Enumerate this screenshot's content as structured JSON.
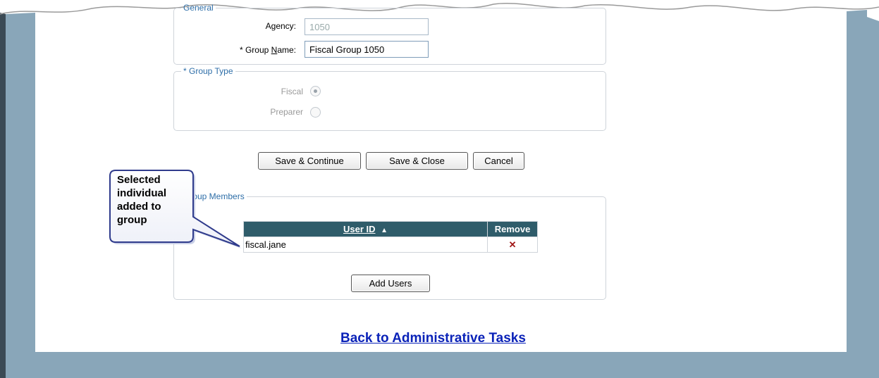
{
  "general": {
    "legend": "General",
    "agency_label": "Agency:",
    "agency_value": "1050",
    "group_name_label_prefix": "* Group ",
    "group_name_label_underlined": "N",
    "group_name_label_suffix": "ame:",
    "group_name_value": "Fiscal Group 1050"
  },
  "group_type": {
    "legend": "* Group Type",
    "options": [
      {
        "label": "Fiscal",
        "checked": true
      },
      {
        "label": "Preparer",
        "checked": false
      }
    ]
  },
  "actions": {
    "save_continue": "Save & Continue",
    "save_close": "Save & Close",
    "cancel": "Cancel"
  },
  "members": {
    "legend": "Group Members",
    "headers": {
      "user_id": "User ID",
      "sort_indicator": "▲",
      "remove": "Remove"
    },
    "rows": [
      {
        "user_id": "fiscal.jane",
        "remove_glyph": "✕"
      }
    ],
    "add_users": "Add Users"
  },
  "callout": {
    "text": "Selected\nindividual\nadded to\ngroup"
  },
  "back_link": "Back to Administrative Tasks",
  "colors": {
    "frame": "#89a6b9",
    "legend": "#2e6ea8",
    "header": "#2f5c6a",
    "link": "#0a22b8",
    "callout_border": "#2f3b8c"
  }
}
